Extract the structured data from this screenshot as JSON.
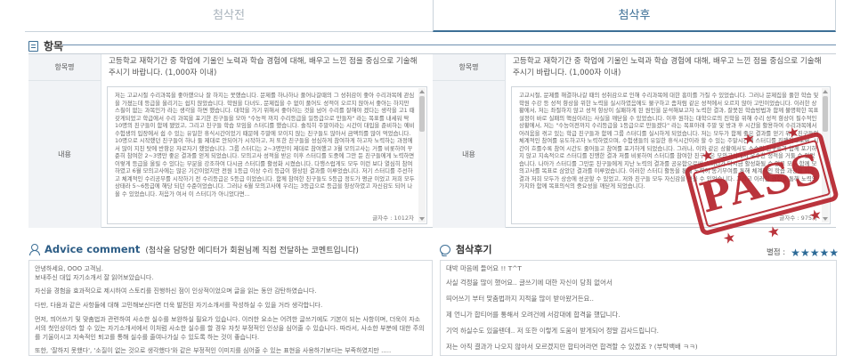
{
  "tabs": {
    "before": "첨삭전",
    "after": "첨삭후"
  },
  "section": {
    "title": "항목"
  },
  "left_item": {
    "question_label": "항목명",
    "question_text": "고등학교 재학기간 중 학업에 기울인 노력과 학습 경험에 대해, 배우고 느낀 점을 중심으로 기술해 주시기 바랍니다. (1,000자 이내)",
    "content_label": "내용",
    "content_text": "저는 고교시절 수리과목을 좋아했으나 잘 하지는 못했습니다. 문제를 하나하나 풀어나갈때의 그 성취감이 좋아 수리과목에 관심을 가졌는데 등급을 올리기는 쉽지 않았습니다. 학원을 다녀도, 문제집을 수 없이 풀어도 성적이 오르지 않아서 좋아는 하지만 스칠이 없는 과목인가 라는 생각을 하면 했습니다. 대학을 가기 위해서 좋아하는 것을 넘어 수리를 잘해야 겠다는 생각을 고1 때 갖게되었고 학급에서 수리 과목을 포기한 친구들을 모아 \"수능적 까지 수리등급을 일등급으로 만들자\" 라는 목표를 내세워 딱 10명의 친구들이 함께 됐었고, 그리고 친구들 학습 모임을 스터디를 했습니다. 솔직히 주말이라는 시간이 대입을 준비하는 예비 수험생의 입장에서 쉽 수 있는 유일한 휴식시간이었기 때문에 주말에 모이지 않는 친구들도 많아서 금액의를 많이 먹었습니다. 10명으로 시작했던 친구들이 하나 둘 제대로 안되어가 시작하고, 저 또한 친구들을 성심하게 참여하게 하고자 노력하는 과정에서 많이 지친 탓에 반항은 자로자기 했었습니다. 그룹 스터디는 2~3명만이 제대로 참여했고 3월 모의고사는 거를 비롯하여 꾸준히 참여한 2~3명만 좋은 결과를 얻게 되었습니다. 모의고사 성적을 받은 이후 스터디를 도중에 그만 둔 친구들에게 노력하면 이렇게 등급을 올릴 수 있다는 부분을 강조하여 다시금 스터디를 활성화 시켰습니다. 다행스럽게도 모두 이런 보다 열심히 참여하였고 6월 모의고사에는 많은 기간이었지만 전원 1등급 이상 수리 등급이 향상된 결과를 이루었습니다. 저기 스터디를 주선하고 체계적인 수리공부를 시작하기 전 수리등급은 5등급 이었습니다. 함께 참여한 친구들도 5등급 정도가 평균 이었고 저희 모두 상태라 5~6등급에 해당 되던 수준이었습니다. 그러나 6월 모의고사에 우리는 3등급으로 등급을 향상하였고 자신감도 되어 나올 수 있었습니다. 처음가 여서 이 스터디가 아니었다면...",
    "char_count": "글자수 : 1012자"
  },
  "right_item": {
    "question_label": "항목명",
    "question_text": "고등학교 재학기간 중 학업에 기울인 노력과 학습 경험에 대해, 배우고 느낀 점을 중심으로 기술해 주시기 바랍니다. (1,000자 이내)",
    "content_label": "내용",
    "content_text": "고교시절, 문제를 해결하나갈 때의 성취감으로 인해 수리과목에 대한 흥미를 가질 수 있었습니다. 그러나 문제집을 풀한 학습 및 학원 수강 등 성적 향상을 위한 노력을 실시하였음에도 불구하고 좀처럼 같은 성적에서 오르지 않아 고민이었습니다. 이러한 상황에서, 저는 좌절하지 않고 성적 향상이 실패하게 된 원인을 분석해보고자 노력한 결과, 잘못된 학습방법과 함께 불명확한 목표설정이 바로 실패의 핵심이라는 사실을 깨닫을 수 있었습니다. 이후 원하는 대학으로의 진학을 위해 수리 성적 향상이 필수적인 상황에서, 저는 \"수능이전까지 수리등급을 1등급으로 만들겠다\" 라는 목표아래 주말 및 방과 후 시간을 활용하여 수리과목에서 어려움을 겪고 있는 학급 친구들과 함께 그룹 스터디를 실시하게 되었습니다. 저는 모두가 함께 좋은 결과를 얻기 위해 친구들의 체계적인 참여를 유도하고자 노력하였으며, 수험생들의 유일한 휴식시간이라 할 수 있는 주말시간에 스터디를 진행하므로써, 시간이 흐를수록 참여 시간도 줄어들고 참여를 포기하게 되었습니다. 그러나, 이와 같은 상황에서도 소수의 친구들과 함께 포기하지 않고 지속적으로 스터디를 진행한 결과 저를 비롯하여 스터디를 참여한 친구들은 모의고사에서 우수한 성적을 거둘 수 있었습니다. 나아가 스터디를 그만둔 친구들에게 지난 노력의 결과를 공유함으로써 스터디가 다시금 활성화될 수 있고 모두 함께 모의고사를 목표로 삼았던 결과를 이루었습니다. 이러한 스터디 활동을 통해 노력이 동기부여를 통해 체계적인 학습 과정을 이룬 결과 저희 모두가 상승에 성공할 수 있었고, 저와 친구들 모두 자신감을 얻을 수 있었습니다. 그리고 이러한 경험을 통해 노력의 가치와 함께 목표의식의 중요성을 깨닫게 되었습니다.",
    "char_count": "글자수 : 975자"
  },
  "stamp": {
    "text": "PASS",
    "color": "#b5232c"
  },
  "advice": {
    "title": "Advice comment",
    "subtitle": "(첨삭을 담당한 에디터가 회원님께 직접 전달하는 코멘트입니다)",
    "paragraphs": [
      "안녕하세요, OOO 고객님.\n보내주신 대입 자기소개서 잘 읽어보았습니다.",
      "자신을 경험을 효과적으로 제시하여 스토리를 진행하신 점이 인상적이었으며 글을 읽는 동안 감탄하였습니다.",
      "다만, 다음과 같은 사항들에 대해 고민해보신다면 더욱 발전된 자기소개서를 작성하실 수 있을 거라 생각합니다.",
      "먼저, 띄어쓰기 및 맞춤법과 관련하여 사소한 실수를 보완하실 필요가 있습니다. 이러한 요소는 어려한 글쓰기에도 기본이 되는 사항이며, 더욱이 자소서의 첫인상이라 할 수 있는 자기소개서에서 이처럼 사소한 실수를 할 경우 자칫 부정적인 인상을 심어줄 수 있습니다. 따라서, 사소한 부분에 대한 주의를 기울이시고 지속적인 퇴고를 통해 실수를 줄여나가실 수 있도록 하는 것이 좋습니다.",
      "또한, '잘하지 못했다', '소질이 없는 것으로 생각했다'와 같은 부정적인 이미지를 심어줄 수 있는 표현을 사용하기보다는 부족하였지만 ....."
    ]
  },
  "review": {
    "title": "첨삭후기",
    "rating_label": "별점 :",
    "rating": 5,
    "rating_max": 5,
    "lines": [
      "대박 마음에 들어요 !! T^T",
      "사실 걱정을 많이 했어요.. 글쓰기에 대한 자신이 당최 없어서",
      "띄어쓰기 부터 맞춤법까지 지적을 많이 받아왔거든요..",
      "제 언니가 합티어를 통해서 오려건에 서강대에 합격을 했답니다.",
      "기억 하실수도 있을텐데.. 저 또한 이렇게 도움이 받게되어 정말 감사드립니다.",
      "저는 아직 결과가 나오지 않아서 모르겠지만 합티어라면 합격할 수 있겠죠 ? (부탁백배 ㅋㅋ)"
    ]
  }
}
